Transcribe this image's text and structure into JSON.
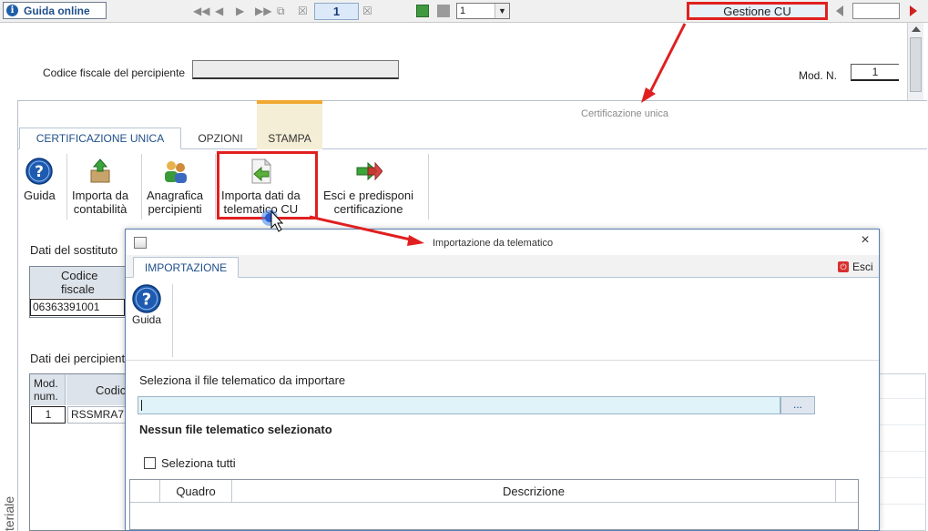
{
  "toolbar": {
    "guida_online": "Guida online",
    "page_number": "1",
    "combo_value": "1",
    "gestione_cu": "Gestione CU"
  },
  "form": {
    "codice_fiscale_label": "Codice fiscale del percipiente",
    "mod_n_label": "Mod. N.",
    "mod_n_value": "1"
  },
  "cu_panel": {
    "title": "Certificazione unica",
    "tabs": [
      {
        "label": "CERTIFICAZIONE UNICA"
      },
      {
        "label": "OPZIONI"
      },
      {
        "label": "STAMPA"
      }
    ],
    "ribbon": [
      {
        "line1": "Guida",
        "line2": ""
      },
      {
        "line1": "Importa da",
        "line2": "contabilità"
      },
      {
        "line1": "Anagrafica",
        "line2": "percipienti"
      },
      {
        "line1": "Importa dati da",
        "line2": "telematico CU"
      },
      {
        "line1": "Esci e predisponi",
        "line2": "certificazione"
      }
    ],
    "sostituto_label": "Dati del sostituto",
    "sostituto_header": "Codice fiscale",
    "sostituto_value": "06363391001",
    "percipienti_label": "Dati dei percipienti",
    "percipienti_col1": "Mod. num.",
    "percipienti_col2": "Codice",
    "percipienti_row_num": "1",
    "percipienti_row_code": "RSSMRA7",
    "side_text": "teriale"
  },
  "dialog": {
    "title": "Importazione da telematico",
    "close": "×",
    "tab": "IMPORTAZIONE",
    "esci": "Esci",
    "guida": "Guida",
    "select_label": "Seleziona il file telematico da importare",
    "browse": "...",
    "no_file": "Nessun file telematico selezionato",
    "select_all": "Seleziona tutti",
    "col_quadro": "Quadro",
    "col_descrizione": "Descrizione"
  },
  "colors": {
    "highlight": "#e02020",
    "accent_blue": "#1f4f8a",
    "stampa_tab": "#f0a830"
  }
}
